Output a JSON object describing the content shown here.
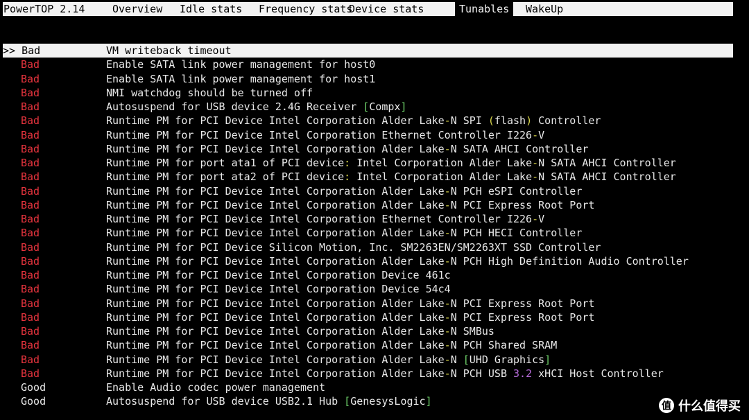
{
  "app": {
    "title": "PowerTOP 2.14"
  },
  "tabs": [
    {
      "label": "Overview"
    },
    {
      "label": "Idle stats"
    },
    {
      "label": "Frequency stats"
    },
    {
      "label": "Device stats"
    },
    {
      "label": "Tunables",
      "active": true
    },
    {
      "label": "WakeUp"
    }
  ],
  "selection_marker": ">> ",
  "rows": [
    {
      "status": "Bad",
      "desc": "VM writeback timeout",
      "selected": true
    },
    {
      "status": "Bad",
      "desc": "Enable SATA link power management for host0"
    },
    {
      "status": "Bad",
      "desc": "Enable SATA link power management for host1"
    },
    {
      "status": "Bad",
      "desc": "NMI watchdog should be turned off"
    },
    {
      "status": "Bad",
      "desc": "Autosuspend for USB device 2.4G Receiver [Compx]"
    },
    {
      "status": "Bad",
      "desc": "Runtime PM for PCI Device Intel Corporation Alder Lake-N SPI (flash) Controller"
    },
    {
      "status": "Bad",
      "desc": "Runtime PM for PCI Device Intel Corporation Ethernet Controller I226-V"
    },
    {
      "status": "Bad",
      "desc": "Runtime PM for PCI Device Intel Corporation Alder Lake-N SATA AHCI Controller"
    },
    {
      "status": "Bad",
      "desc": "Runtime PM for port ata1 of PCI device: Intel Corporation Alder Lake-N SATA AHCI Controller"
    },
    {
      "status": "Bad",
      "desc": "Runtime PM for port ata2 of PCI device: Intel Corporation Alder Lake-N SATA AHCI Controller"
    },
    {
      "status": "Bad",
      "desc": "Runtime PM for PCI Device Intel Corporation Alder Lake-N PCH eSPI Controller"
    },
    {
      "status": "Bad",
      "desc": "Runtime PM for PCI Device Intel Corporation Alder Lake-N PCI Express Root Port"
    },
    {
      "status": "Bad",
      "desc": "Runtime PM for PCI Device Intel Corporation Ethernet Controller I226-V"
    },
    {
      "status": "Bad",
      "desc": "Runtime PM for PCI Device Intel Corporation Alder Lake-N PCH HECI Controller"
    },
    {
      "status": "Bad",
      "desc": "Runtime PM for PCI Device Silicon Motion, Inc. SM2263EN/SM2263XT SSD Controller"
    },
    {
      "status": "Bad",
      "desc": "Runtime PM for PCI Device Intel Corporation Alder Lake-N PCH High Definition Audio Controller"
    },
    {
      "status": "Bad",
      "desc": "Runtime PM for PCI Device Intel Corporation Device 461c"
    },
    {
      "status": "Bad",
      "desc": "Runtime PM for PCI Device Intel Corporation Device 54c4"
    },
    {
      "status": "Bad",
      "desc": "Runtime PM for PCI Device Intel Corporation Alder Lake-N PCI Express Root Port"
    },
    {
      "status": "Bad",
      "desc": "Runtime PM for PCI Device Intel Corporation Alder Lake-N PCI Express Root Port"
    },
    {
      "status": "Bad",
      "desc": "Runtime PM for PCI Device Intel Corporation Alder Lake-N SMBus"
    },
    {
      "status": "Bad",
      "desc": "Runtime PM for PCI Device Intel Corporation Alder Lake-N PCH Shared SRAM"
    },
    {
      "status": "Bad",
      "desc": "Runtime PM for PCI Device Intel Corporation Alder Lake-N [UHD Graphics]"
    },
    {
      "status": "Bad",
      "desc": "Runtime PM for PCI Device Intel Corporation Alder Lake-N PCH USB 3.2 xHCI Host Controller"
    },
    {
      "status": "Good",
      "desc": "Enable Audio codec power management"
    },
    {
      "status": "Good",
      "desc": "Autosuspend for USB device USB2.1 Hub [GenesysLogic]"
    }
  ],
  "colors": {
    "bad": "#e8343e",
    "good": "#e8e8e8",
    "bracket_highlight": "#6fd36a",
    "paren_highlight": "#d7d44a",
    "number_highlight": "#b56ad8"
  },
  "watermark": {
    "icon": "value-logo-icon",
    "text": "什么值得买"
  }
}
